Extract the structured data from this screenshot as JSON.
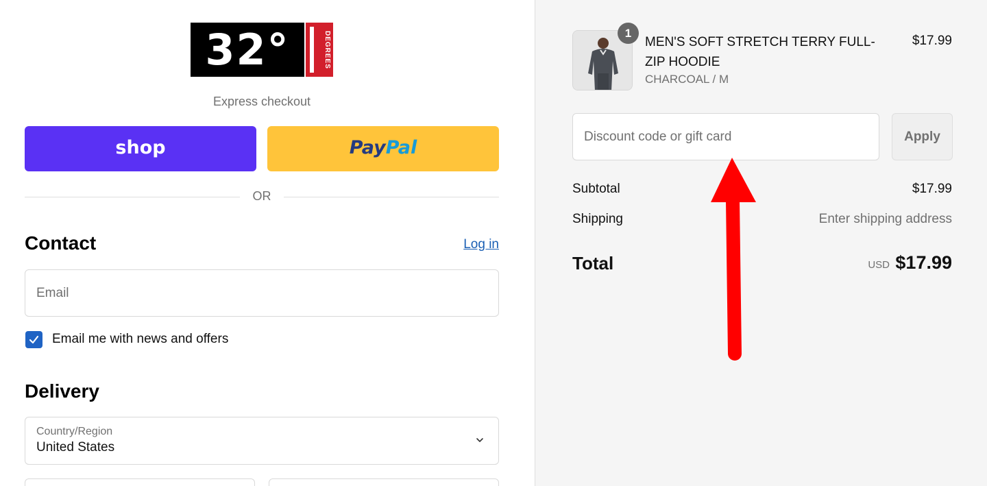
{
  "store": {
    "logo_number": "32°",
    "logo_side_text": "DEGREES"
  },
  "express": {
    "label": "Express checkout",
    "shop_label": "shop",
    "paypal_pay": "Pay",
    "paypal_pal": "Pal"
  },
  "divider": {
    "or": "OR"
  },
  "contact": {
    "heading": "Contact",
    "login": "Log in",
    "email_placeholder": "Email",
    "newsletter_label": "Email me with news and offers",
    "newsletter_checked": true
  },
  "delivery": {
    "heading": "Delivery",
    "country_label": "Country/Region",
    "country_value": "United States"
  },
  "cart": {
    "item": {
      "quantity": "1",
      "name": "MEN'S SOFT STRETCH TERRY FULL-ZIP HOODIE",
      "variant": "CHARCOAL / M",
      "price": "$17.99",
      "image_icon": "product-thumbnail"
    },
    "discount_placeholder": "Discount code or gift card",
    "apply_label": "Apply",
    "subtotal_label": "Subtotal",
    "subtotal_value": "$17.99",
    "shipping_label": "Shipping",
    "shipping_value": "Enter shipping address",
    "total_label": "Total",
    "currency": "USD",
    "total_value": "$17.99"
  },
  "colors": {
    "shop_purple": "#5a31f4",
    "paypal_yellow": "#ffc43a",
    "link_blue": "#1a5fb4",
    "annotation_red": "#ff0000"
  }
}
